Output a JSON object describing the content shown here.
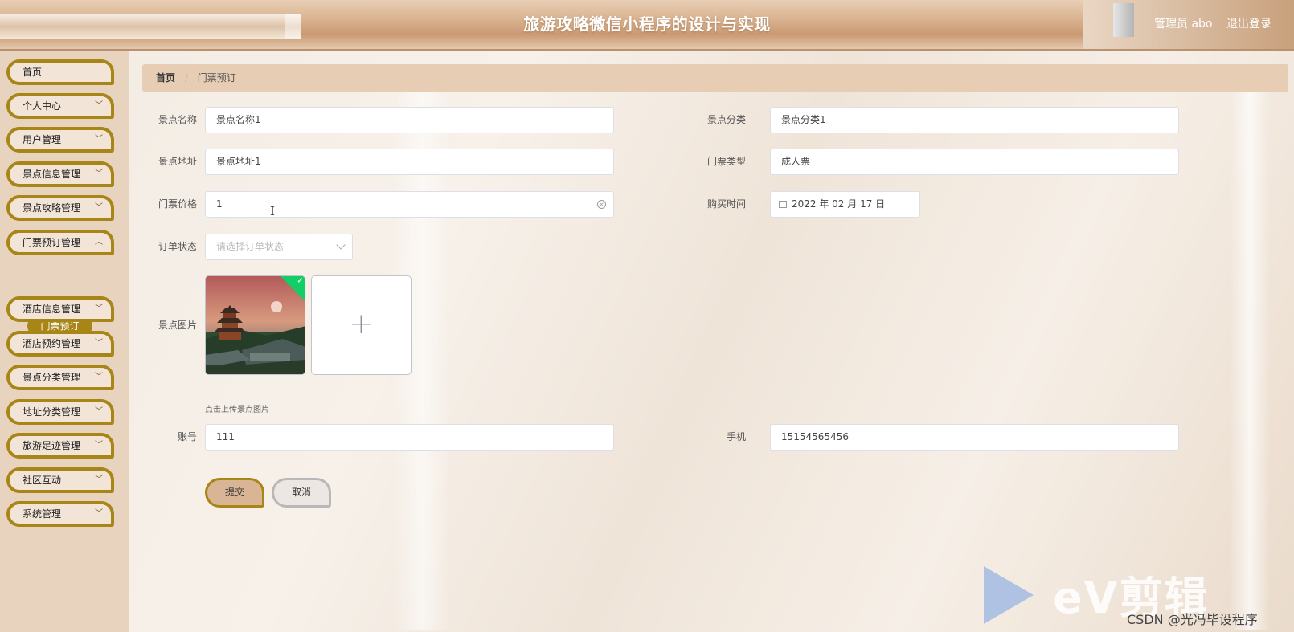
{
  "header": {
    "title": "旅游攻略微信小程序的设计与实现",
    "admin_label": "管理员 abo",
    "logout_label": "退出登录"
  },
  "sidebar": {
    "items": [
      {
        "label": "首页",
        "has_children": false
      },
      {
        "label": "个人中心",
        "has_children": true
      },
      {
        "label": "用户管理",
        "has_children": true
      },
      {
        "label": "景点信息管理",
        "has_children": true
      },
      {
        "label": "景点攻略管理",
        "has_children": true
      },
      {
        "label": "门票预订管理",
        "has_children": true,
        "expanded": true
      },
      {
        "label": "酒店信息管理",
        "has_children": true
      },
      {
        "label": "酒店预约管理",
        "has_children": true
      },
      {
        "label": "景点分类管理",
        "has_children": true
      },
      {
        "label": "地址分类管理",
        "has_children": true
      },
      {
        "label": "旅游足迹管理",
        "has_children": true
      },
      {
        "label": "社区互动",
        "has_children": true
      },
      {
        "label": "系统管理",
        "has_children": true
      }
    ],
    "active_sub_item": "门票预订"
  },
  "breadcrumb": {
    "home": "首页",
    "separator": "/",
    "current": "门票预订"
  },
  "form": {
    "scenic_name": {
      "label": "景点名称",
      "value": "景点名称1"
    },
    "scenic_category": {
      "label": "景点分类",
      "value": "景点分类1"
    },
    "scenic_address": {
      "label": "景点地址",
      "value": "景点地址1"
    },
    "ticket_type": {
      "label": "门票类型",
      "value": "成人票"
    },
    "ticket_price": {
      "label": "门票价格",
      "value": "1"
    },
    "purchase_time": {
      "label": "购买时间",
      "value": "2022 年 02 月 17 日"
    },
    "order_status": {
      "label": "订单状态",
      "placeholder": "请选择订单状态"
    },
    "scenic_image": {
      "label": "景点图片",
      "tip": "点击上传景点图片"
    },
    "account": {
      "label": "账号",
      "value": "111"
    },
    "phone": {
      "label": "手机",
      "value": "15154565456"
    }
  },
  "buttons": {
    "submit": "提交",
    "cancel": "取消"
  },
  "watermark": {
    "brand": "eV剪辑",
    "csdn": "CSDN @光冯毕设程序"
  },
  "colors": {
    "accent_gold": "#a88517",
    "header_bg": "#d7ae8a",
    "sidebar_bg": "#e8d3bf",
    "success_green": "#13ce66"
  }
}
